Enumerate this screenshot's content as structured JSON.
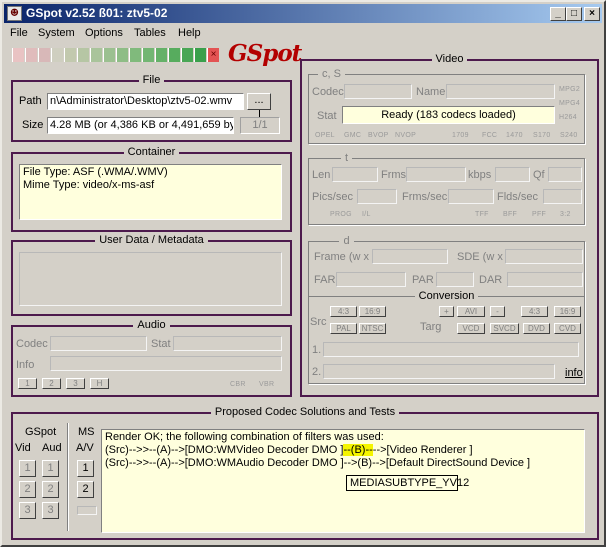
{
  "window": {
    "title": "GSpot v2.52 ß01: ztv5-02",
    "icon_glyph": "☻",
    "buttons": [
      "_",
      "□",
      "×"
    ]
  },
  "menu": [
    "File",
    "System",
    "Options",
    "Tables",
    "Help"
  ],
  "meter": {
    "colors": [
      "#e9c3c3",
      "#e0bcbc",
      "#d8b8b8",
      "#cfcfc0",
      "#c2c9ae",
      "#b6c6a4",
      "#a9c49b",
      "#9bc090",
      "#8ebd86",
      "#80ba7c",
      "#73b673",
      "#65b168",
      "#57ac5e",
      "#49a655",
      "#3aa04c",
      "#e35353"
    ],
    "end_mark": "×"
  },
  "logo": "GSpot",
  "file": {
    "title": "File",
    "path_label": "Path",
    "path_value": "n\\Administrator\\Desktop\\ztv5-02.wmv",
    "browse": "...",
    "size_label": "Size",
    "size_value": "4.28 MB (or 4,386 KB or 4,491,659 byt",
    "counter": "1/1"
  },
  "container": {
    "title": "Container",
    "file_type": "File Type: ASF (.WMA/.WMV)",
    "mime_type": "Mime Type: video/x-ms-asf"
  },
  "user_data": {
    "title": "User Data / Metadata"
  },
  "audio": {
    "title": "Audio",
    "codec": "Codec",
    "stat": "Stat",
    "info": "Info",
    "buttons": [
      "1",
      "2",
      "3",
      "H"
    ],
    "right_labels": [
      "CBR",
      "VBR"
    ]
  },
  "video": {
    "title": "Video",
    "cs": {
      "title": "c, S",
      "codec": "Codec",
      "name": "Name",
      "stat": "Stat",
      "stat_value": "Ready (183 codecs loaded)",
      "side": [
        "MPG2",
        "MPG4",
        "H264"
      ],
      "bottom": [
        "OPEL",
        "GMC",
        "BVOP",
        "NVOP",
        "1709",
        "FCC",
        "1470",
        "S170",
        "S240"
      ]
    },
    "t": {
      "title": "t",
      "len": "Len",
      "frms": "Frms",
      "kbps": "kbps",
      "qf": "Qf",
      "pics": "Pics/sec",
      "frmsec": "Frms/sec",
      "flds": "Flds/sec",
      "bottom_left": [
        "PROG",
        "I/L"
      ],
      "bottom_right": [
        "TFF",
        "BFF",
        "PFF",
        "3:2"
      ]
    },
    "d": {
      "title": "d",
      "frame": "Frame (w x",
      "sde": "SDE (w x",
      "far": "FAR",
      "par": "PAR",
      "dar": "DAR"
    },
    "conversion": {
      "title": "Conversion",
      "src": "Src",
      "targ": "Targ",
      "src_btns": [
        "4:3",
        "16:9",
        "PAL",
        "NTSC"
      ],
      "targ_top": [
        "+",
        "AVI",
        "-",
        "4:3",
        "16:9"
      ],
      "targ_bot": [
        "VCD",
        "SVCD",
        "DVD",
        "CVD"
      ],
      "line1": "1.",
      "line2": "2.",
      "info": "info"
    }
  },
  "proposed": {
    "title": "Proposed Codec Solutions and Tests",
    "gspot": "GSpot",
    "vid": "Vid",
    "aud": "Aud",
    "ms": "MS",
    "av": "A/V",
    "nums": [
      "1",
      "2",
      "3"
    ],
    "lines": [
      "Render OK; the following combination of filters was used:",
      "(Src)-->>--(A)-->[DMO:WMVideo Decoder DMO ]",
      "-->[Video Renderer ]",
      "(Src)-->>--(A)-->[DMO:WMAudio Decoder DMO ]-->(B)-->[Default DirectSound Device ]"
    ],
    "hl": "--(B)--",
    "tooltip": "MEDIASUBTYPE_YV12"
  }
}
